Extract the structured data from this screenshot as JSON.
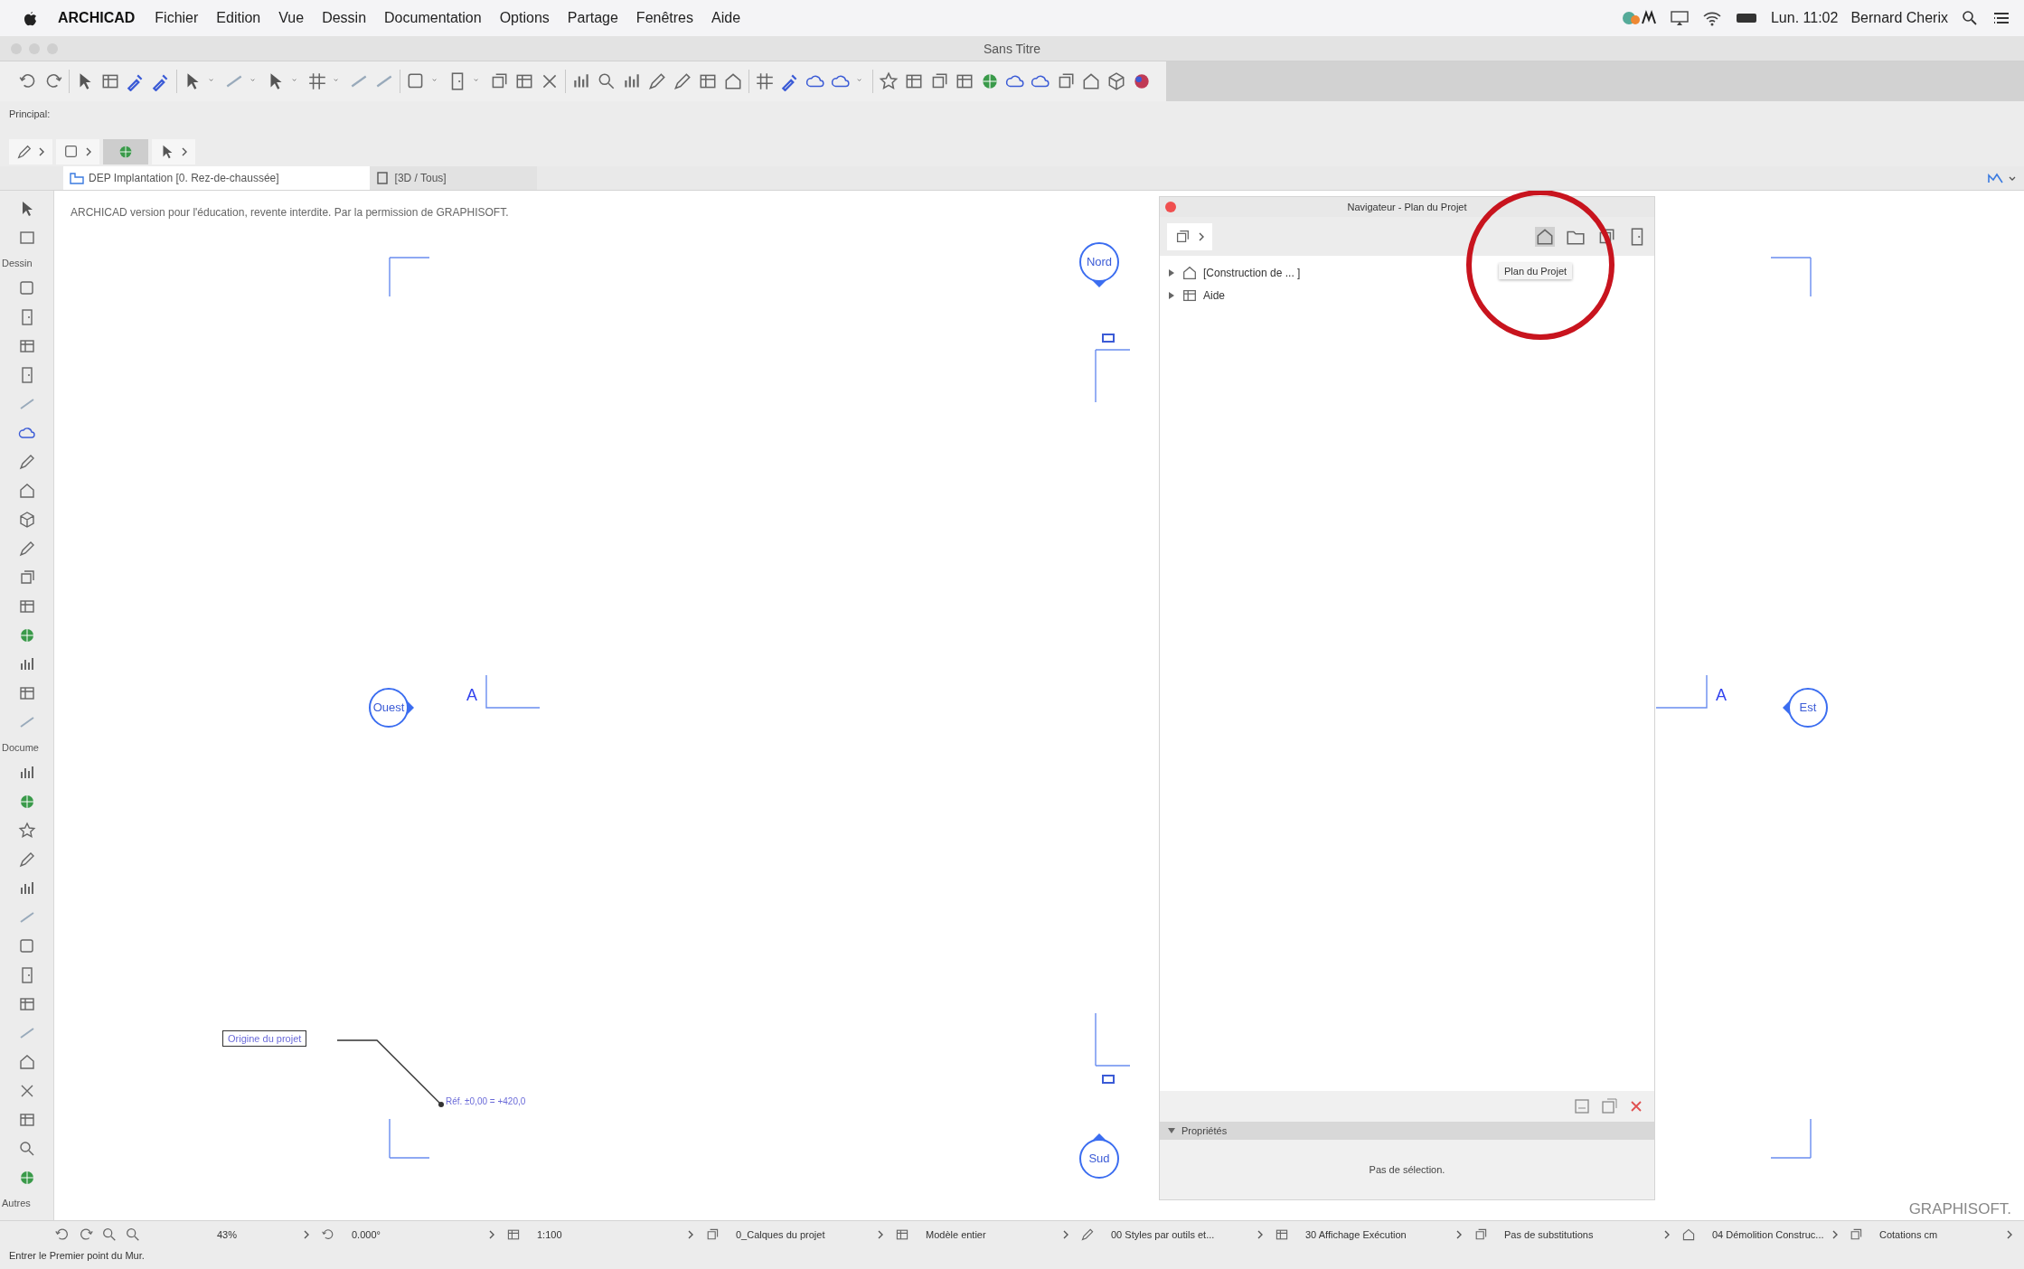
{
  "menu_bar": {
    "app": "ARCHICAD",
    "items": [
      "Fichier",
      "Edition",
      "Vue",
      "Dessin",
      "Documentation",
      "Options",
      "Partage",
      "Fenêtres",
      "Aide"
    ],
    "clock": "Lun. 11:02",
    "user": "Bernard Cherix"
  },
  "window": {
    "title": "Sans Titre"
  },
  "info_box": {
    "label": "Principal:"
  },
  "tabs": [
    {
      "label": "DEP Implantation [0. Rez-de-chaussée]",
      "selected": true
    },
    {
      "label": "[3D / Tous]",
      "selected": false
    }
  ],
  "toolbox": {
    "sections": [
      "Dessin",
      "Docume",
      "Autres"
    ]
  },
  "canvas": {
    "notice": "ARCHICAD version pour l'éducation, revente interdite. Par la permission de GRAPHISOFT.",
    "markers": [
      {
        "label": "Nord"
      },
      {
        "label": "Ouest"
      },
      {
        "label": "Est"
      },
      {
        "label": "Sud"
      }
    ],
    "section_labels": [
      "A",
      "A"
    ],
    "origin_label": "Origine du projet",
    "elevation_note": "Réf. ±0,00 = +420,0",
    "brand": "GRAPHISOFT."
  },
  "navigator": {
    "title": "Navigateur - Plan du Projet",
    "tooltip": "Plan du Projet",
    "tree": [
      {
        "label": "[Construction de ... ]",
        "expanded": false
      },
      {
        "label": "Aide",
        "expanded": false
      }
    ],
    "properties": {
      "title": "Propriétés",
      "expanded": true,
      "message": "Pas de sélection."
    }
  },
  "status_bar": {
    "items": [
      "43%",
      "0.000°",
      "1:100",
      "0_Calques du projet",
      "Modèle entier",
      "00 Styles par outils et...",
      "30 Affichage Exécution",
      "Pas de substitutions",
      "04 Démolition Construc...",
      "Cotations cm"
    ]
  },
  "prompt": "Entrer le Premier point du Mur."
}
